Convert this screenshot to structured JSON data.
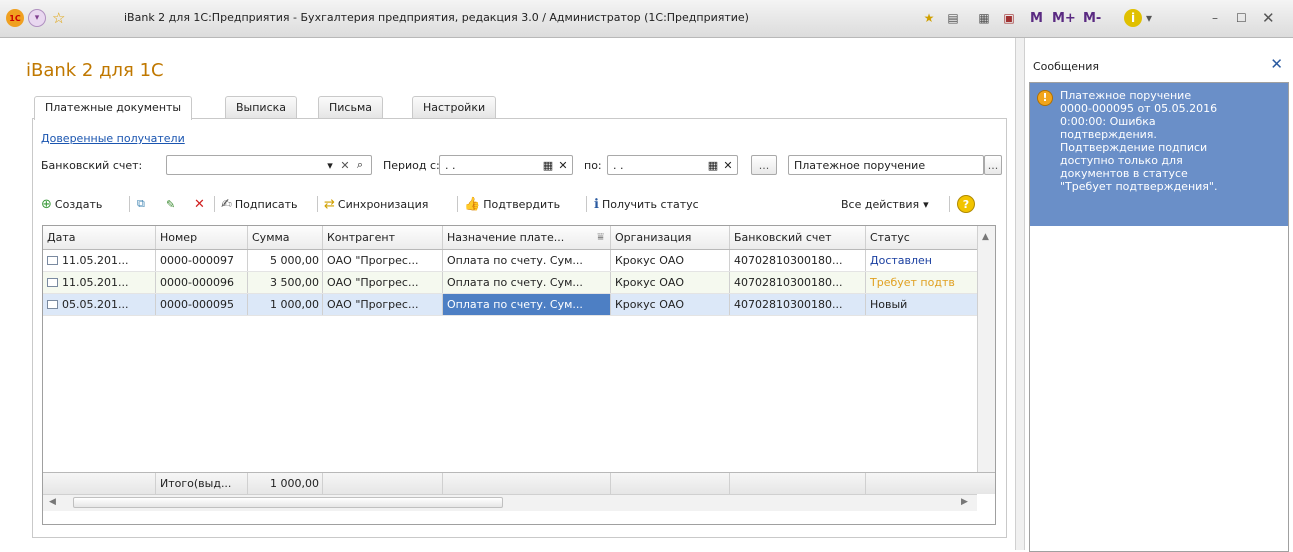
{
  "window": {
    "title": "iBank 2 для 1С:Предприятия - Бухгалтерия предприятия, редакция 3.0 / Администратор  (1С:Предприятие)",
    "m_labels": [
      "M",
      "M+",
      "M-"
    ]
  },
  "app": {
    "title": "iBank 2 для 1С"
  },
  "tabs": [
    {
      "label": "Платежные документы"
    },
    {
      "label": "Выписка"
    },
    {
      "label": "Письма"
    },
    {
      "label": "Настройки"
    }
  ],
  "filters": {
    "trusted_link": "Доверенные получатели",
    "account_label": "Банковский счет:",
    "account_value": "",
    "period_from_label": "Период с:",
    "period_from_value": ". .",
    "period_to_label": "по:",
    "period_to_value": ". .",
    "period_button": "...",
    "doc_type_value": "Платежное поручение",
    "doc_type_button": "..."
  },
  "toolbar": {
    "create": "Создать",
    "sign": "Подписать",
    "sync": "Синхронизация",
    "confirm": "Подтвердить",
    "get_status": "Получить статус",
    "all_actions": "Все действия",
    "help": "?"
  },
  "table": {
    "columns": [
      "Дата",
      "Номер",
      "Сумма",
      "Контрагент",
      "Назначение плате...",
      "Организация",
      "Банковский счет",
      "Статус"
    ],
    "rows": [
      {
        "date": "11.05.201...",
        "number": "0000-000097",
        "amount": "5 000,00",
        "counterparty": "ОАО \"Прогрес...",
        "purpose": "Оплата по счету. Сум...",
        "org": "Крокус ОАО",
        "account": "40702810300180...",
        "status": "Доставлен",
        "status_color": "#1a3fa0"
      },
      {
        "date": "11.05.201...",
        "number": "0000-000096",
        "amount": "3 500,00",
        "counterparty": "ОАО \"Прогрес...",
        "purpose": "Оплата по счету. Сум...",
        "org": "Крокус ОАО",
        "account": "40702810300180...",
        "status": "Требует подтв",
        "status_color": "#e0a020"
      },
      {
        "date": "05.05.201...",
        "number": "0000-000095",
        "amount": "1 000,00",
        "counterparty": "ОАО \"Прогрес...",
        "purpose": "Оплата по счету. Сум...",
        "org": "Крокус ОАО",
        "account": "40702810300180...",
        "status": "Новый",
        "status_color": "#222222"
      }
    ],
    "footer": {
      "label": "Итого(выд...",
      "amount": "1 000,00"
    }
  },
  "messages": {
    "title": "Сообщения",
    "items": [
      {
        "text": "Платежное поручение\n0000-000095 от 05.05.2016\n0:00:00: Ошибка\nподтверждения.\nПодтверждение подписи\nдоступно только для\nдокументов в статусе\n\"Требует подтверждения\"."
      }
    ]
  }
}
